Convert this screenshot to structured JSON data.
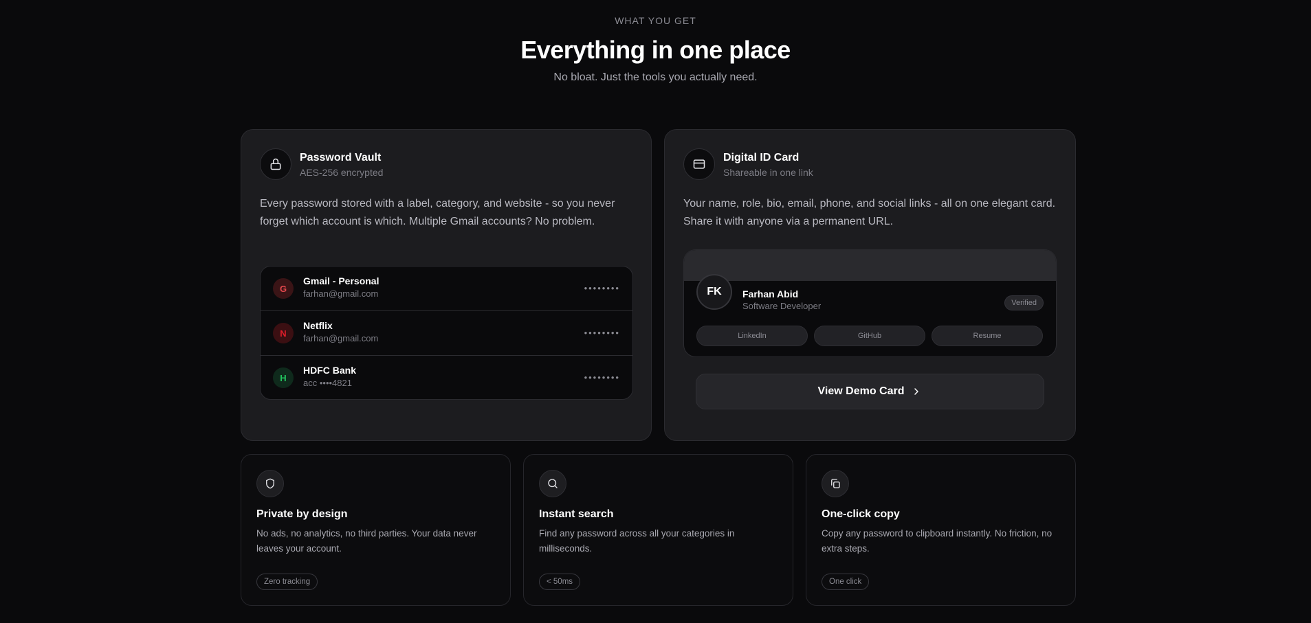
{
  "hero": {
    "eyebrow": "WHAT YOU GET",
    "title": "Everything in one place",
    "subtitle": "No bloat. Just the tools you actually need."
  },
  "vault": {
    "icon": "lock-icon",
    "title": "Password Vault",
    "subtitle": "AES-256 encrypted",
    "description": "Every password stored with a label, category, and website - so you never forget which account is which. Multiple Gmail accounts? No problem.",
    "entries": [
      {
        "initial": "G",
        "name": "Gmail - Personal",
        "detail": "farhan@gmail.com",
        "masked": "••••••••",
        "color": "#e5484d",
        "bg": "#3a1416"
      },
      {
        "initial": "N",
        "name": "Netflix",
        "detail": "farhan@gmail.com",
        "masked": "••••••••",
        "color": "#e11d2a",
        "bg": "#3b0f12"
      },
      {
        "initial": "H",
        "name": "HDFC Bank",
        "detail": "acc ••••4821",
        "masked": "••••••••",
        "color": "#22c55e",
        "bg": "#0f2a1c"
      }
    ]
  },
  "idcard": {
    "icon": "credit-card-icon",
    "title": "Digital ID Card",
    "subtitle": "Shareable in one link",
    "description": "Your name, role, bio, email, phone, and social links - all on one elegant card. Share it with anyone via a permanent URL.",
    "initials": "FK",
    "name": "Farhan Abid",
    "role": "Software Developer",
    "badge": "Verified",
    "links": [
      "LinkedIn",
      "GitHub",
      "Resume"
    ],
    "cta": "View Demo Card"
  },
  "features": [
    {
      "icon": "shield-icon",
      "title": "Private by design",
      "description": "No ads, no analytics, no third parties. Your data never leaves your account.",
      "tag": "Zero tracking"
    },
    {
      "icon": "search-icon",
      "title": "Instant search",
      "description": "Find any password across all your categories in milliseconds.",
      "tag": "< 50ms"
    },
    {
      "icon": "copy-icon",
      "title": "One-click copy",
      "description": "Copy any password to clipboard instantly. No friction, no extra steps.",
      "tag": "One click"
    }
  ]
}
